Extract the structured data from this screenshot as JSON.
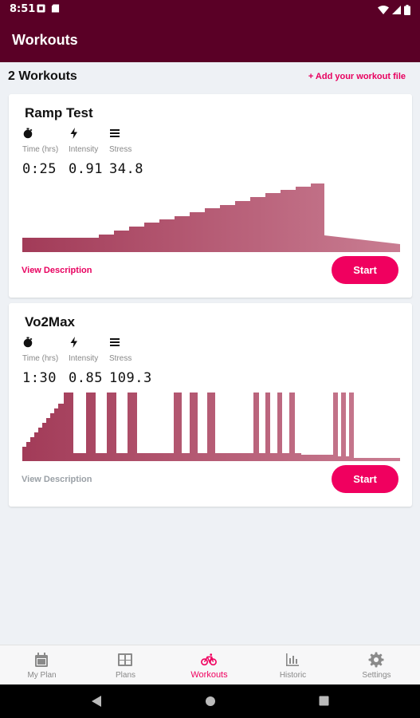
{
  "status": {
    "time": "8:51"
  },
  "app": {
    "title": "Workouts"
  },
  "header": {
    "count_label": "2 Workouts",
    "add_label": "+ Add your workout file"
  },
  "metric_labels": {
    "time": "Time (hrs)",
    "intensity": "Intensity",
    "stress": "Stress"
  },
  "workouts": [
    {
      "title": "Ramp Test",
      "time": "0:25",
      "intensity": "0.91",
      "stress": "34.8",
      "description_label": "View Description",
      "description_color": "#e8005f",
      "start_label": "Start"
    },
    {
      "title": "Vo2Max",
      "time": "1:30",
      "intensity": "0.85",
      "stress": "109.3",
      "description_label": "View Description",
      "description_color": "#9aa0a6",
      "start_label": "Start"
    }
  ],
  "nav": [
    {
      "label": "My Plan",
      "icon": "calendar-icon",
      "active": false
    },
    {
      "label": "Plans",
      "icon": "grid-icon",
      "active": false
    },
    {
      "label": "Workouts",
      "icon": "bicycle-icon",
      "active": true
    },
    {
      "label": "Historic",
      "icon": "bar-chart-icon",
      "active": false
    },
    {
      "label": "Settings",
      "icon": "gear-icon",
      "active": false
    }
  ],
  "colors": {
    "primary": "#5a0026",
    "accent": "#f0005f",
    "chart_start": "#a23b58",
    "chart_end": "#c97d92"
  }
}
